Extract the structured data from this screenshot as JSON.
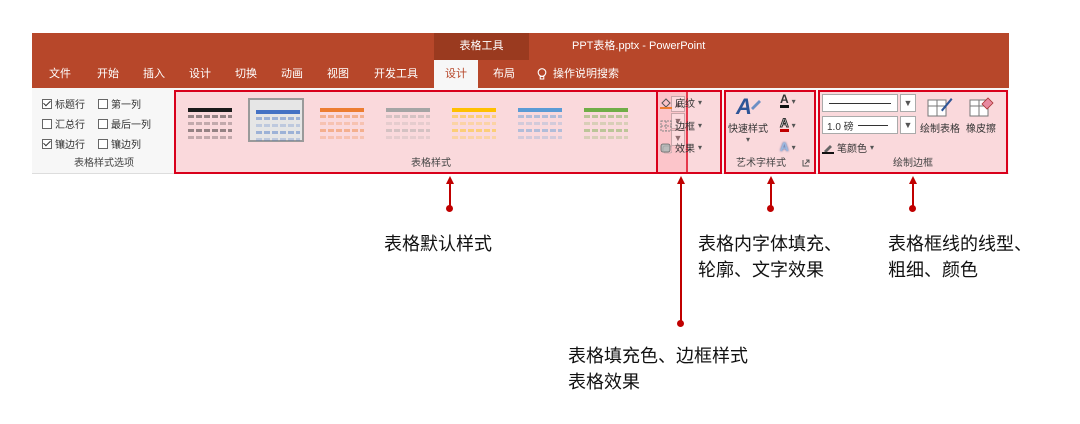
{
  "title_bar": {
    "context_tab": "表格工具",
    "window_title": "PPT表格.pptx - PowerPoint"
  },
  "tabs": [
    {
      "label": "文件"
    },
    {
      "label": "开始"
    },
    {
      "label": "插入"
    },
    {
      "label": "设计"
    },
    {
      "label": "切换"
    },
    {
      "label": "动画"
    },
    {
      "label": "视图"
    },
    {
      "label": "开发工具"
    },
    {
      "label": "设计",
      "active": true
    },
    {
      "label": "布局"
    }
  ],
  "search_label": "操作说明搜索",
  "style_options": {
    "group_label": "表格样式选项",
    "items": [
      {
        "label": "标题行",
        "checked": true
      },
      {
        "label": "第一列",
        "checked": false
      },
      {
        "label": "汇总行",
        "checked": false
      },
      {
        "label": "最后一列",
        "checked": false
      },
      {
        "label": "镶边行",
        "checked": true
      },
      {
        "label": "镶边列",
        "checked": false
      }
    ]
  },
  "table_styles": {
    "group_label": "表格样式",
    "thumbnail_colors": [
      "#1a1a1a",
      "#4472c4",
      "#ed7d31",
      "#a5a5a5",
      "#ffc000",
      "#5b9bd5",
      "#70ad47"
    ]
  },
  "fill_group": {
    "shading": "底纹",
    "borders": "边框",
    "effects": "效果"
  },
  "wordart": {
    "group_label": "艺术字样式",
    "quick_styles": "快速样式",
    "text_fill_icon": "A",
    "text_outline_icon": "A",
    "text_effects_icon": "A"
  },
  "draw_borders": {
    "group_label": "绘制边框",
    "pen_weight": "1.0 磅",
    "pen_color": "笔颜色",
    "draw_table": "绘制表格",
    "eraser": "橡皮擦"
  },
  "annotations": {
    "table_default_style": "表格默认样式",
    "fill_border_line1": "表格填充色、边框样式",
    "fill_border_line2": "表格效果",
    "font_fill_line1": "表格内字体填充、",
    "font_fill_line2": "轮廓、文字效果",
    "border_line_line1": "表格框线的线型、",
    "border_line_line2": "粗细、颜色"
  },
  "colors": {
    "accent": "#b7472a",
    "context_tab": "#9a3a1f",
    "highlight": "#d9001b",
    "annotation": "#c00000"
  }
}
